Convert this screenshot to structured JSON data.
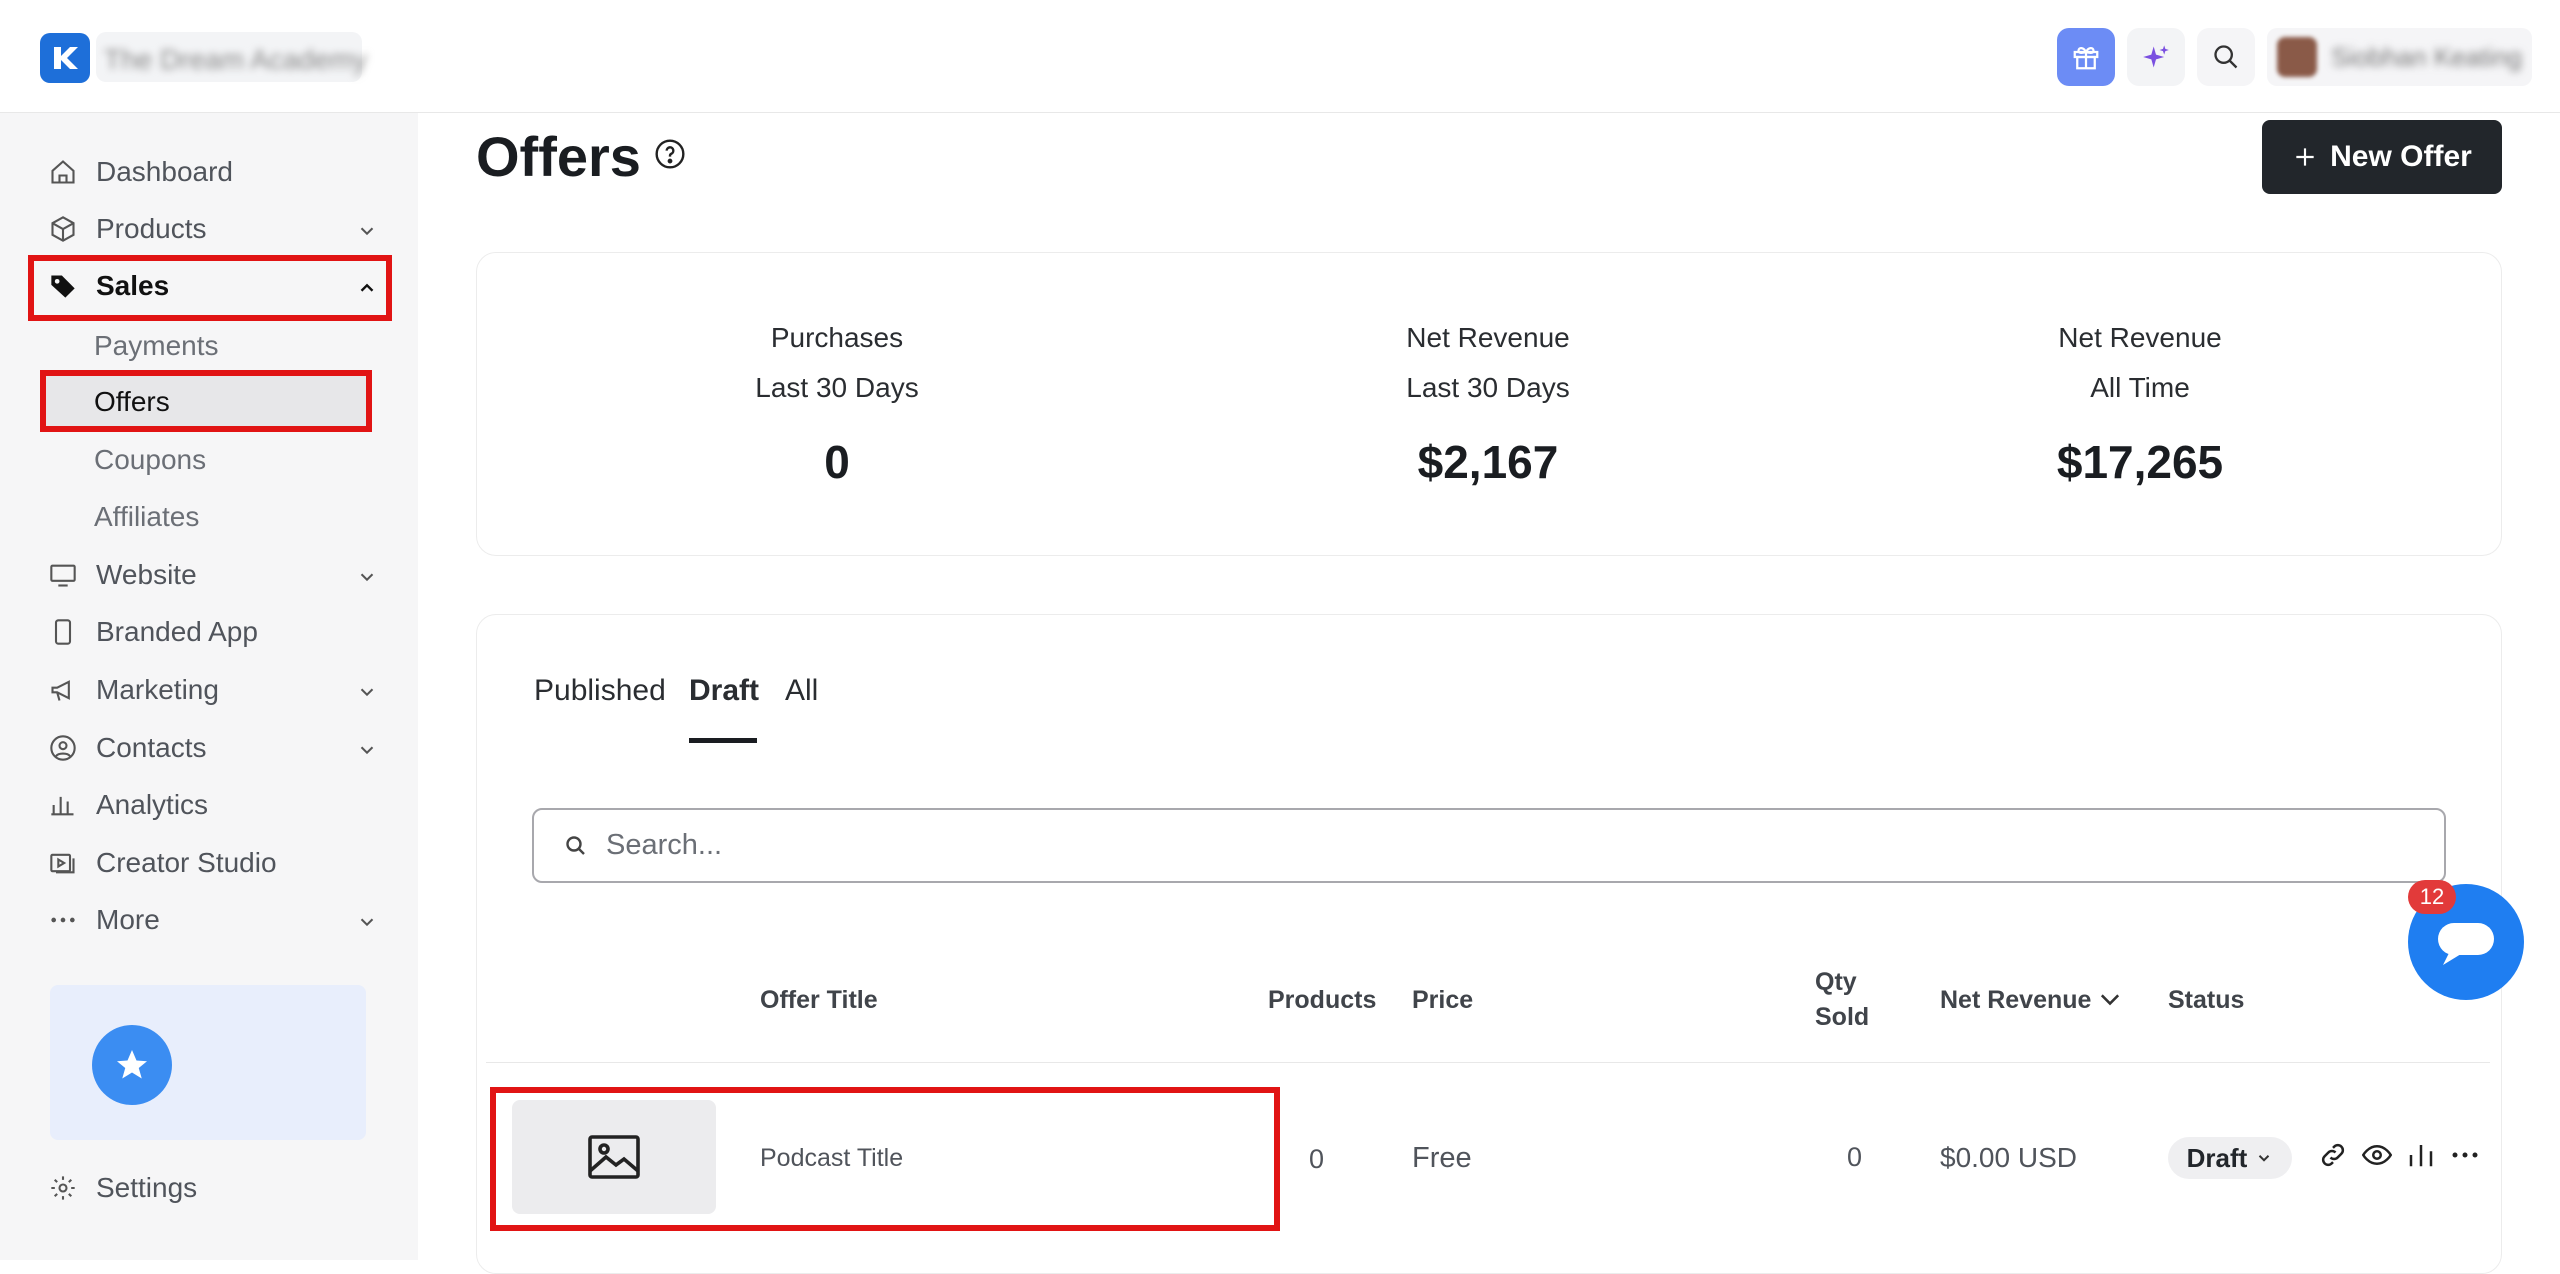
{
  "topbar": {
    "school_name": "The Dream Academy",
    "user_name": "Siobhan Keating",
    "accent": "#1e6fd9"
  },
  "sidebar": {
    "items": [
      {
        "label": "Dashboard",
        "icon": "home-icon"
      },
      {
        "label": "Products",
        "icon": "box-icon",
        "expandable": true
      },
      {
        "label": "Sales",
        "icon": "tag-icon",
        "expanded": true
      },
      {
        "label": "Website",
        "icon": "monitor-icon",
        "expandable": true
      },
      {
        "label": "Branded App",
        "icon": "phone-icon"
      },
      {
        "label": "Marketing",
        "icon": "megaphone-icon",
        "expandable": true
      },
      {
        "label": "Contacts",
        "icon": "user-circle-icon",
        "expandable": true
      },
      {
        "label": "Analytics",
        "icon": "bar-chart-icon"
      },
      {
        "label": "Creator Studio",
        "icon": "video-icon"
      },
      {
        "label": "More",
        "icon": "dots-icon",
        "expandable": true
      },
      {
        "label": "Settings",
        "icon": "gear-icon"
      }
    ],
    "sales_sub": [
      "Payments",
      "Offers",
      "Coupons",
      "Affiliates"
    ],
    "selected_sub": "Offers"
  },
  "header": {
    "title": "Offers",
    "new_offer_label": "New Offer"
  },
  "stats": [
    {
      "line1": "Purchases",
      "line2": "Last 30 Days",
      "value": "0"
    },
    {
      "line1": "Net Revenue",
      "line2": "Last 30 Days",
      "value": "$2,167"
    },
    {
      "line1": "Net Revenue",
      "line2": "All Time",
      "value": "$17,265"
    }
  ],
  "tabs": [
    "Published",
    "Draft",
    "All"
  ],
  "active_tab": "Draft",
  "search": {
    "placeholder": "Search..."
  },
  "table": {
    "columns": [
      "Offer Title",
      "Products",
      "Price",
      "Qty",
      "Sold",
      "Net Revenue",
      "Status"
    ],
    "rows": [
      {
        "title": "Podcast Title",
        "products": "0",
        "price": "Free",
        "qty_sold": "0",
        "net_revenue": "$0.00 USD",
        "status": "Draft"
      }
    ]
  },
  "chat": {
    "badge": "12"
  }
}
